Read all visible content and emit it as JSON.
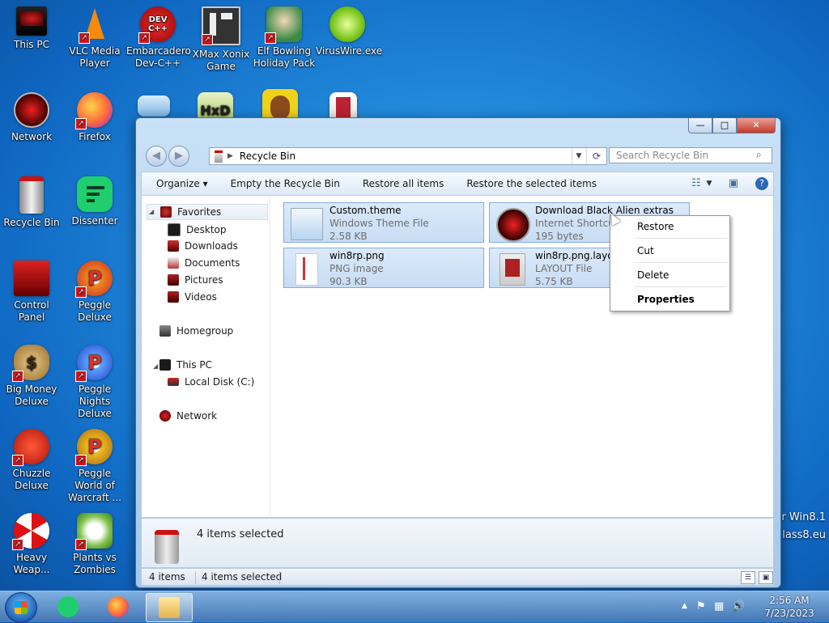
{
  "desktop": {
    "icons": [
      {
        "label": "This PC"
      },
      {
        "label": "VLC Media Player"
      },
      {
        "label": "Embarcadero Dev-C++"
      },
      {
        "label": "XMax Xonix Game"
      },
      {
        "label": "Elf Bowling Holiday Pack"
      },
      {
        "label": "VirusWire.exe"
      },
      {
        "label": "Network"
      },
      {
        "label": "Firefox"
      },
      {
        "label": "Recycle Bin"
      },
      {
        "label": "Dissenter"
      },
      {
        "label": "Control Panel"
      },
      {
        "label": "Peggle Deluxe"
      },
      {
        "label": "Big Money Deluxe"
      },
      {
        "label": "Peggle Nights Deluxe"
      },
      {
        "label": "Chuzzle Deluxe"
      },
      {
        "label": "Peggle World of Warcraft ..."
      },
      {
        "label": "Heavy Weap..."
      },
      {
        "label": "Plants vs Zombies"
      }
    ],
    "dev_glyph": "DEV C++",
    "watermark_line1": "r Win8.1",
    "watermark_line2": "lass8.eu"
  },
  "window": {
    "address": "Recycle Bin",
    "search_placeholder": "Search Recycle Bin",
    "caption": {
      "minimize": "—",
      "maximize": "□",
      "close": "✕"
    },
    "toolbar": {
      "organize": "Organize ▾",
      "empty": "Empty the Recycle Bin",
      "restore_all": "Restore all items",
      "restore_selected": "Restore the selected items"
    },
    "nav": {
      "favorites": "Favorites",
      "desktop": "Desktop",
      "downloads": "Downloads",
      "documents": "Documents",
      "pictures": "Pictures",
      "videos": "Videos",
      "homegroup": "Homegroup",
      "this_pc": "This PC",
      "local_disk": "Local Disk (C:)",
      "network": "Network"
    },
    "files": [
      {
        "name": "Custom.theme",
        "type": "Windows Theme File",
        "size": "2.58 KB"
      },
      {
        "name": "Download Black Alien extras",
        "type": "Internet Shortcut",
        "size": "195 bytes"
      },
      {
        "name": "win8rp.png",
        "type": "PNG image",
        "size": "90.3 KB"
      },
      {
        "name": "win8rp.png.layout",
        "type": "LAYOUT File",
        "size": "5.75 KB"
      }
    ],
    "details": "4 items selected",
    "status": {
      "count": "4 items",
      "selected": "4 items selected"
    }
  },
  "context_menu": {
    "restore": "Restore",
    "cut": "Cut",
    "delete": "Delete",
    "properties": "Properties"
  },
  "taskbar": {
    "time": "2:56 AM",
    "date": "7/23/2023"
  },
  "colors": {
    "accent": "#2e67b8",
    "selection": "#c7dcf4",
    "close_button": "#c4392a"
  }
}
